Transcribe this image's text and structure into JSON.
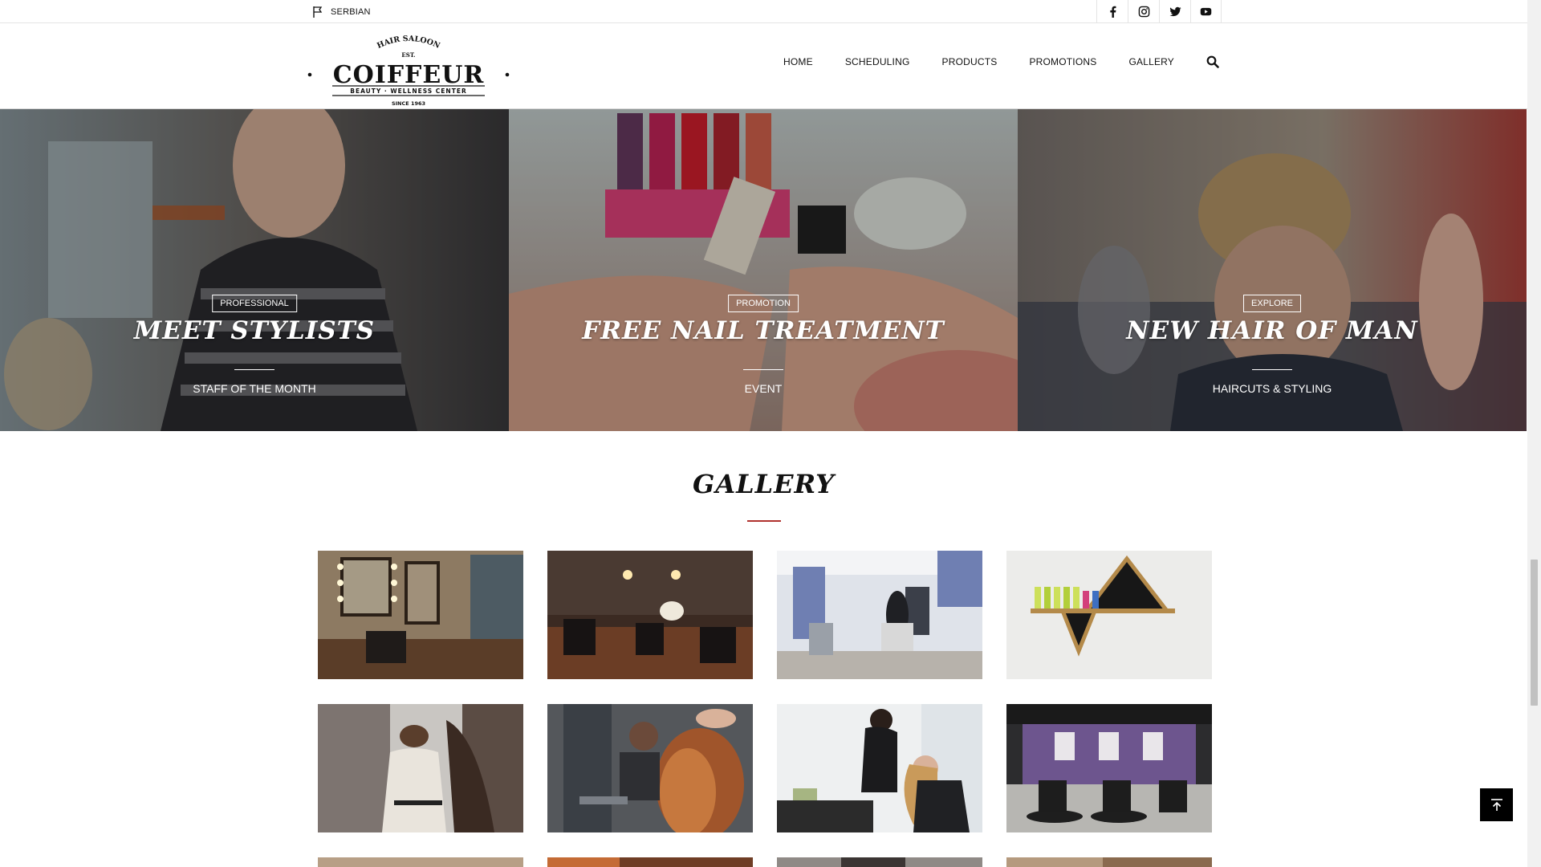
{
  "topbar": {
    "language": "SERBIAN",
    "language_icon": "flag-icon",
    "social": [
      {
        "name": "facebook-icon"
      },
      {
        "name": "instagram-icon"
      },
      {
        "name": "twitter-icon"
      },
      {
        "name": "youtube-icon"
      }
    ]
  },
  "header": {
    "logo": {
      "top_line": "HAIR SALOON",
      "est": "EST.",
      "name": "COIFFEUR",
      "tagline": "BEAUTY · WELLNESS CENTER",
      "since": "SINCE 1963"
    },
    "nav": [
      "HOME",
      "SCHEDULING",
      "PRODUCTS",
      "PROMOTIONS",
      "GALLERY"
    ],
    "search_icon": "search-icon"
  },
  "hero": [
    {
      "tag": "PROFESSIONAL",
      "title": "MEET STYLISTS",
      "subtitle": "STAFF OF THE MONTH"
    },
    {
      "tag": "PROMOTION",
      "title": "FREE NAIL TREATMENT",
      "subtitle": "EVENT"
    },
    {
      "tag": "EXPLORE",
      "title": "NEW HAIR OF MAN",
      "subtitle": "HAIRCUTS & STYLING"
    }
  ],
  "gallery": {
    "title": "GALLERY",
    "accent_color": "#b0322e"
  },
  "back_to_top_icon": "arrow-up-icon"
}
